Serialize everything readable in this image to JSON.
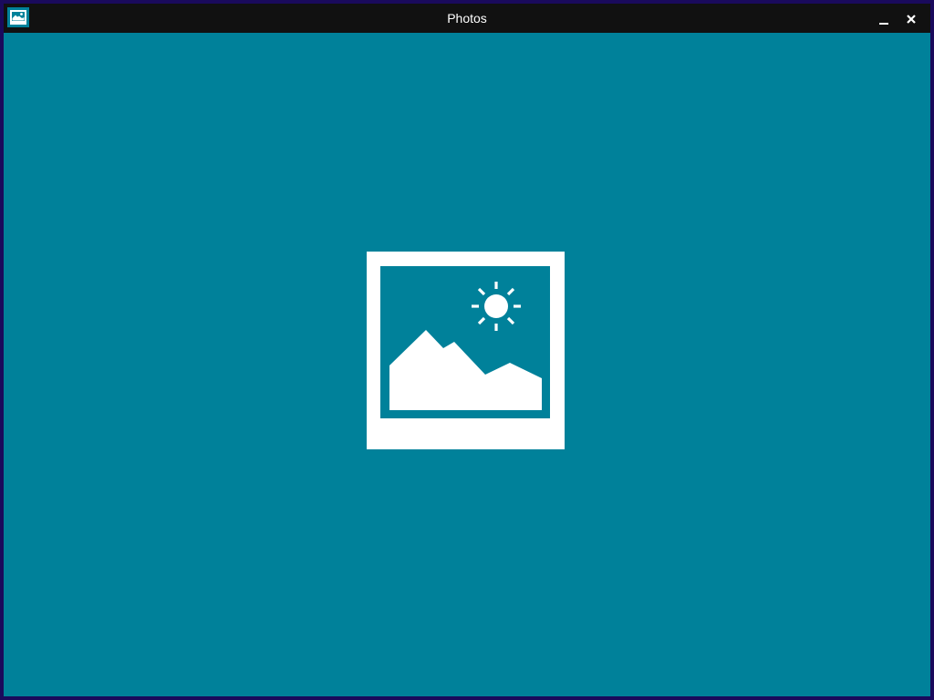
{
  "window": {
    "title": "Photos",
    "app_icon": "photos-app-icon",
    "controls": {
      "minimize_icon": "minimize-icon",
      "close_icon": "close-icon"
    }
  },
  "splash": {
    "icon": "photo-placeholder-icon"
  },
  "colors": {
    "background": "#00819a",
    "titlebar": "#111111",
    "title_text": "#ffffff",
    "desktop_border": "#1a0a5c",
    "icon": "#ffffff"
  }
}
